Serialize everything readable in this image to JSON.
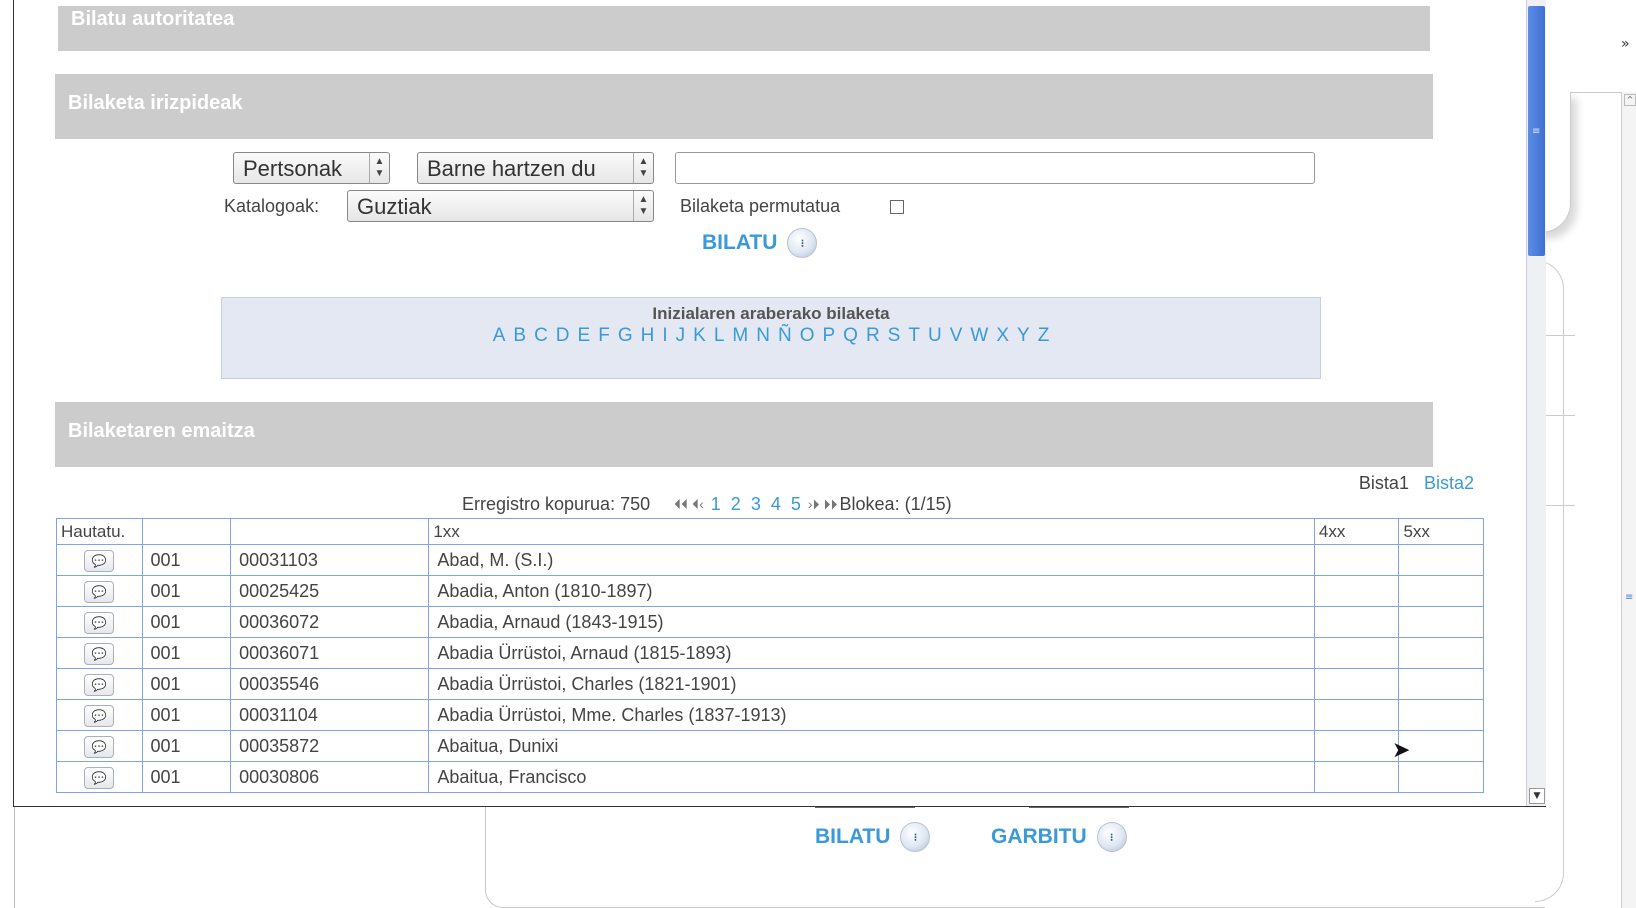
{
  "header": {
    "title": "Bilatu autoritatea"
  },
  "criteria": {
    "title": "Bilaketa irizpideak",
    "type_select": "Pertsonak",
    "mode_select": "Barne hartzen du",
    "search_value": "",
    "catalog_label": "Katalogoak:",
    "catalog_select": "Guztiak",
    "permuted_label": "Bilaketa permutatua",
    "permuted_checked": false,
    "search_button": "BILATU"
  },
  "initials": {
    "title": "Inizialaren araberako bilaketa",
    "letters": [
      "A",
      "B",
      "C",
      "D",
      "E",
      "F",
      "G",
      "H",
      "I",
      "J",
      "K",
      "L",
      "M",
      "N",
      "Ñ",
      "O",
      "P",
      "Q",
      "R",
      "S",
      "T",
      "U",
      "V",
      "W",
      "X",
      "Y",
      "Z"
    ]
  },
  "results": {
    "title": "Bilaketaren emaitza",
    "view1": "Bista1",
    "view2": "Bista2",
    "total_label": "Erregistro kopurua: 750",
    "pages": [
      "1",
      "2",
      "3",
      "4",
      "5"
    ],
    "block_label": "Blokea: (1/15)",
    "columns": [
      "Hautatu.",
      "",
      "",
      "1xx",
      "4xx",
      "5xx"
    ],
    "rows": [
      {
        "code": "001",
        "id": "00031103",
        "name": "Abad, M. (S.I.)"
      },
      {
        "code": "001",
        "id": "00025425",
        "name": "Abadia, Anton (1810-1897)"
      },
      {
        "code": "001",
        "id": "00036072",
        "name": "Abadia, Arnaud (1843-1915)"
      },
      {
        "code": "001",
        "id": "00036071",
        "name": "Abadia Ürrüstoi, Arnaud (1815-1893)"
      },
      {
        "code": "001",
        "id": "00035546",
        "name": "Abadia Ürrüstoi, Charles (1821-1901)"
      },
      {
        "code": "001",
        "id": "00031104",
        "name": "Abadia Ürrüstoi, Mme. Charles (1837-1913)"
      },
      {
        "code": "001",
        "id": "00035872",
        "name": "Abaitua, Dunixi"
      },
      {
        "code": "001",
        "id": "00030806",
        "name": "Abaitua, Francisco"
      }
    ]
  },
  "background": {
    "search_button": "BILATU",
    "clear_button": "GARBITU"
  },
  "colors": {
    "link": "#3a9ad9",
    "header_bg": "#cccccc",
    "table_border": "#7fa4e6"
  }
}
